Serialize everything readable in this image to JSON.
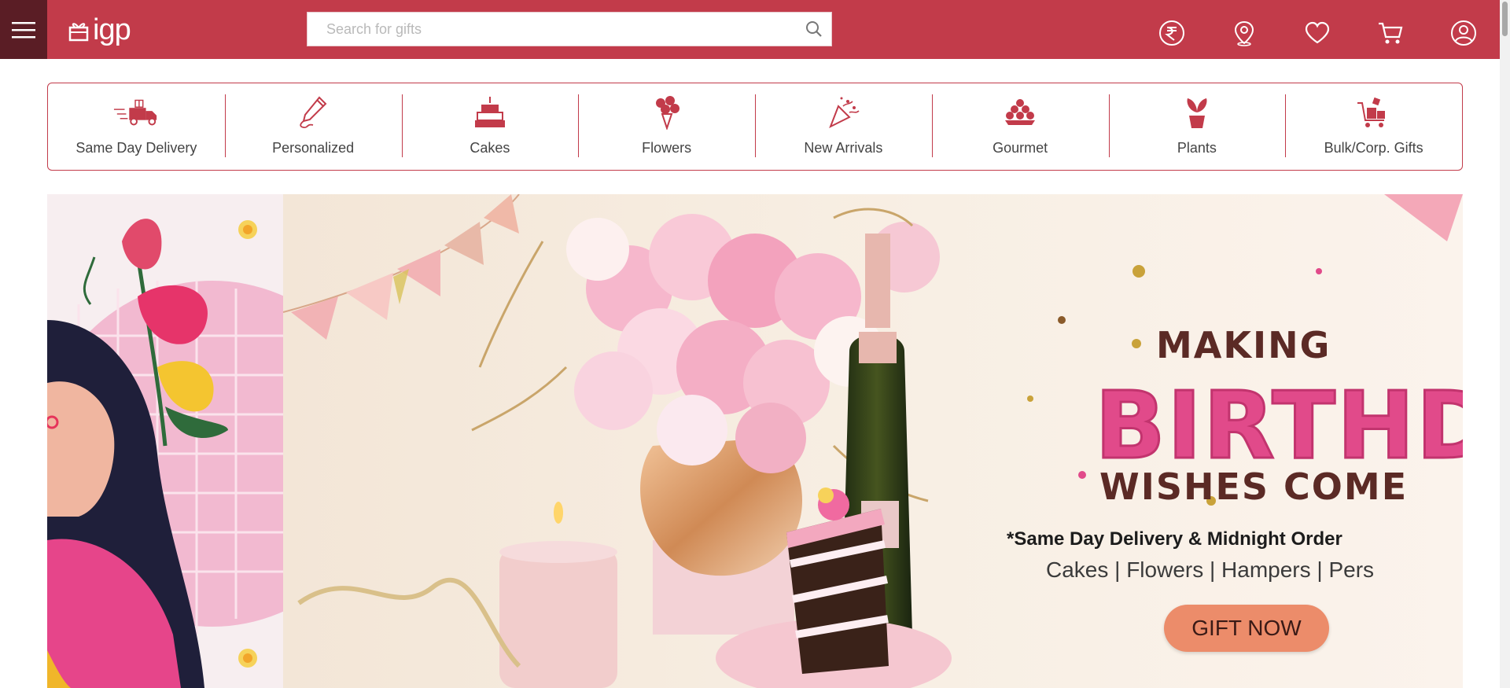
{
  "header": {
    "logo_text": "igp",
    "search": {
      "placeholder": "Search for gifts",
      "value": ""
    },
    "icons": [
      {
        "name": "currency-rupee-icon"
      },
      {
        "name": "location-pin-icon"
      },
      {
        "name": "wishlist-heart-icon"
      },
      {
        "name": "cart-icon"
      },
      {
        "name": "account-icon"
      }
    ]
  },
  "categories": [
    {
      "label": "Same Day Delivery",
      "icon": "delivery-truck-icon"
    },
    {
      "label": "Personalized",
      "icon": "pencil-icon"
    },
    {
      "label": "Cakes",
      "icon": "cake-icon"
    },
    {
      "label": "Flowers",
      "icon": "bouquet-icon"
    },
    {
      "label": "New Arrivals",
      "icon": "party-popper-icon"
    },
    {
      "label": "Gourmet",
      "icon": "sweets-plate-icon"
    },
    {
      "label": "Plants",
      "icon": "potted-plant-icon"
    },
    {
      "label": "Bulk/Corp. Gifts",
      "icon": "gift-cart-icon"
    }
  ],
  "banner": {
    "making": "MAKING",
    "birthday": "BIRTHD",
    "wishes": "WISHES COME",
    "delivery_note": "*Same Day Delivery & Midnight Order",
    "categories_line": "Cakes | Flowers | Hampers | Pers",
    "cta_label": "GIFT NOW"
  },
  "colors": {
    "brand": "#c23b4a",
    "menu_bg": "#5a1d25",
    "cta": "#ec8c6a",
    "birthday_pink": "#e14a8a"
  }
}
